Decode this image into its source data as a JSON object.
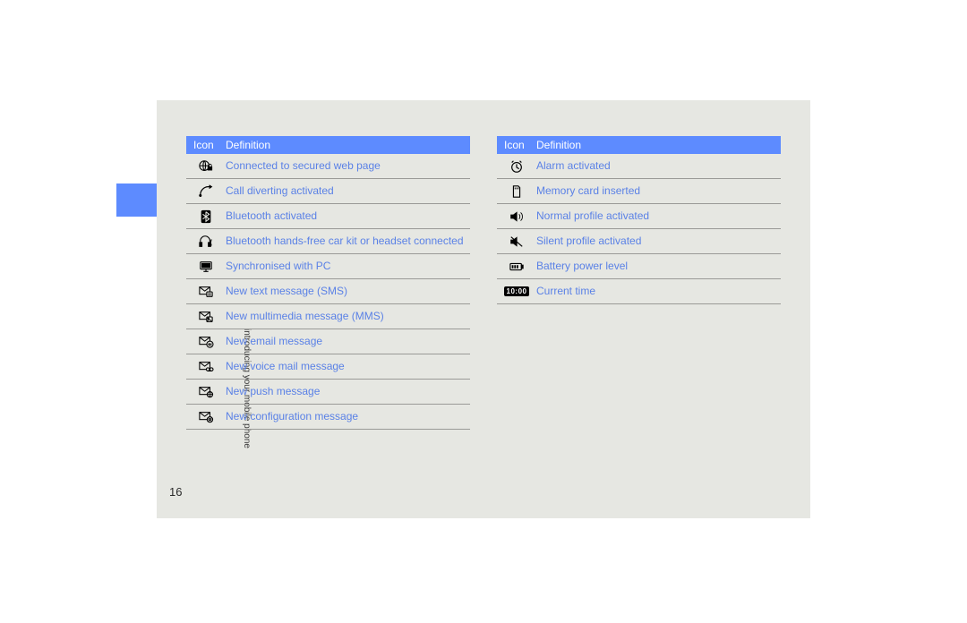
{
  "side_label": "introducing your mobile phone",
  "page_number": "16",
  "table_header": {
    "icon": "Icon",
    "definition": "Definition"
  },
  "time_badge": "10:00",
  "left": [
    {
      "icon": "globe-lock",
      "text": "Connected to secured web page"
    },
    {
      "icon": "call-divert",
      "text": "Call diverting activated"
    },
    {
      "icon": "bluetooth",
      "text": "Bluetooth activated"
    },
    {
      "icon": "bt-headset",
      "text": "Bluetooth hands-free car kit or headset connected"
    },
    {
      "icon": "pc-sync",
      "text": "Synchronised with PC"
    },
    {
      "icon": "sms",
      "text": "New text message (SMS)"
    },
    {
      "icon": "mms",
      "text": "New multimedia message (MMS)"
    },
    {
      "icon": "email",
      "text": "New email message"
    },
    {
      "icon": "voicemail",
      "text": "New voice mail message"
    },
    {
      "icon": "push",
      "text": "New push message"
    },
    {
      "icon": "config",
      "text": "New configuration message"
    }
  ],
  "right": [
    {
      "icon": "alarm",
      "text": "Alarm activated"
    },
    {
      "icon": "memory-card",
      "text": "Memory card inserted"
    },
    {
      "icon": "speaker",
      "text": "Normal profile activated"
    },
    {
      "icon": "speaker-mute",
      "text": "Silent profile activated"
    },
    {
      "icon": "battery",
      "text": "Battery power level"
    },
    {
      "icon": "time",
      "text": "Current time"
    }
  ]
}
